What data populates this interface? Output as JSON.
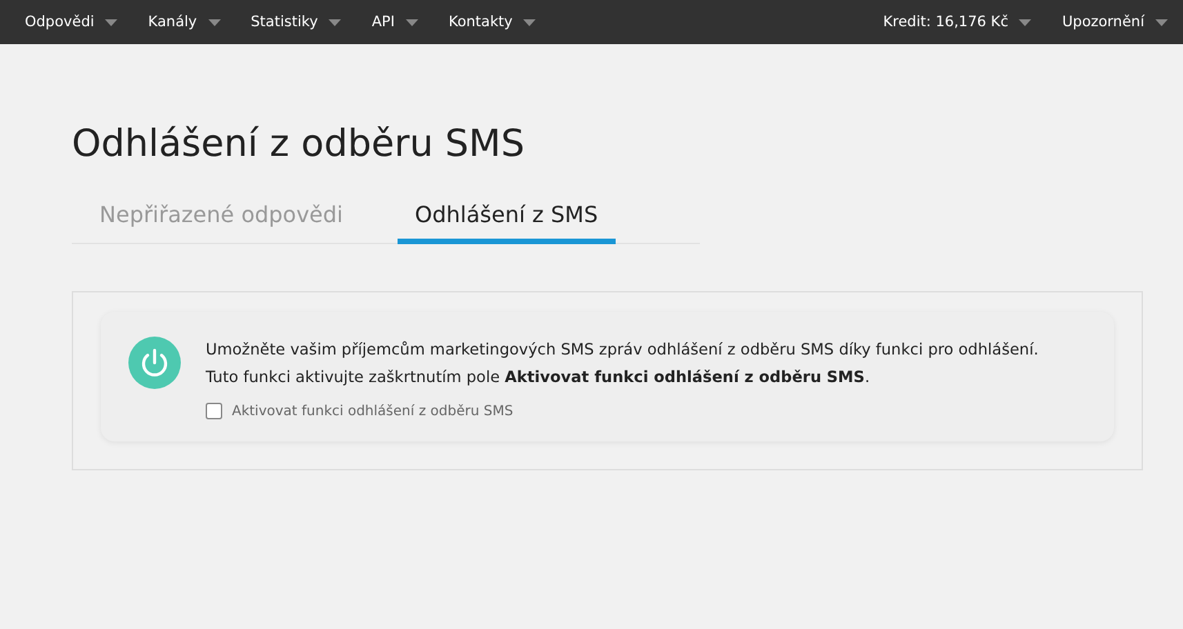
{
  "nav": {
    "left": [
      {
        "label": "Odpovědi"
      },
      {
        "label": "Kanály"
      },
      {
        "label": "Statistiky"
      },
      {
        "label": "API"
      },
      {
        "label": "Kontakty"
      }
    ],
    "right": [
      {
        "label": "Kredit: 16,176 Kč"
      },
      {
        "label": "Upozornění"
      }
    ]
  },
  "title": "Odhlášení z odběru SMS",
  "tabs": [
    {
      "label": "Nepřiřazené odpovědi",
      "selected": false
    },
    {
      "label": "Odhlášení z SMS",
      "selected": true
    }
  ],
  "notice": {
    "text": "Umožněte vašim příjemcům marketingových SMS zpráv odhlášení z odběru SMS díky funkci pro odhlášení. Tuto funkci aktivujte zaškrtnutím pole **Aktivovat funkci odhlášení z odběru SMS**.",
    "checkbox": {
      "label": "Aktivovat funkci odhlášení z odběru SMS",
      "checked": false
    }
  }
}
